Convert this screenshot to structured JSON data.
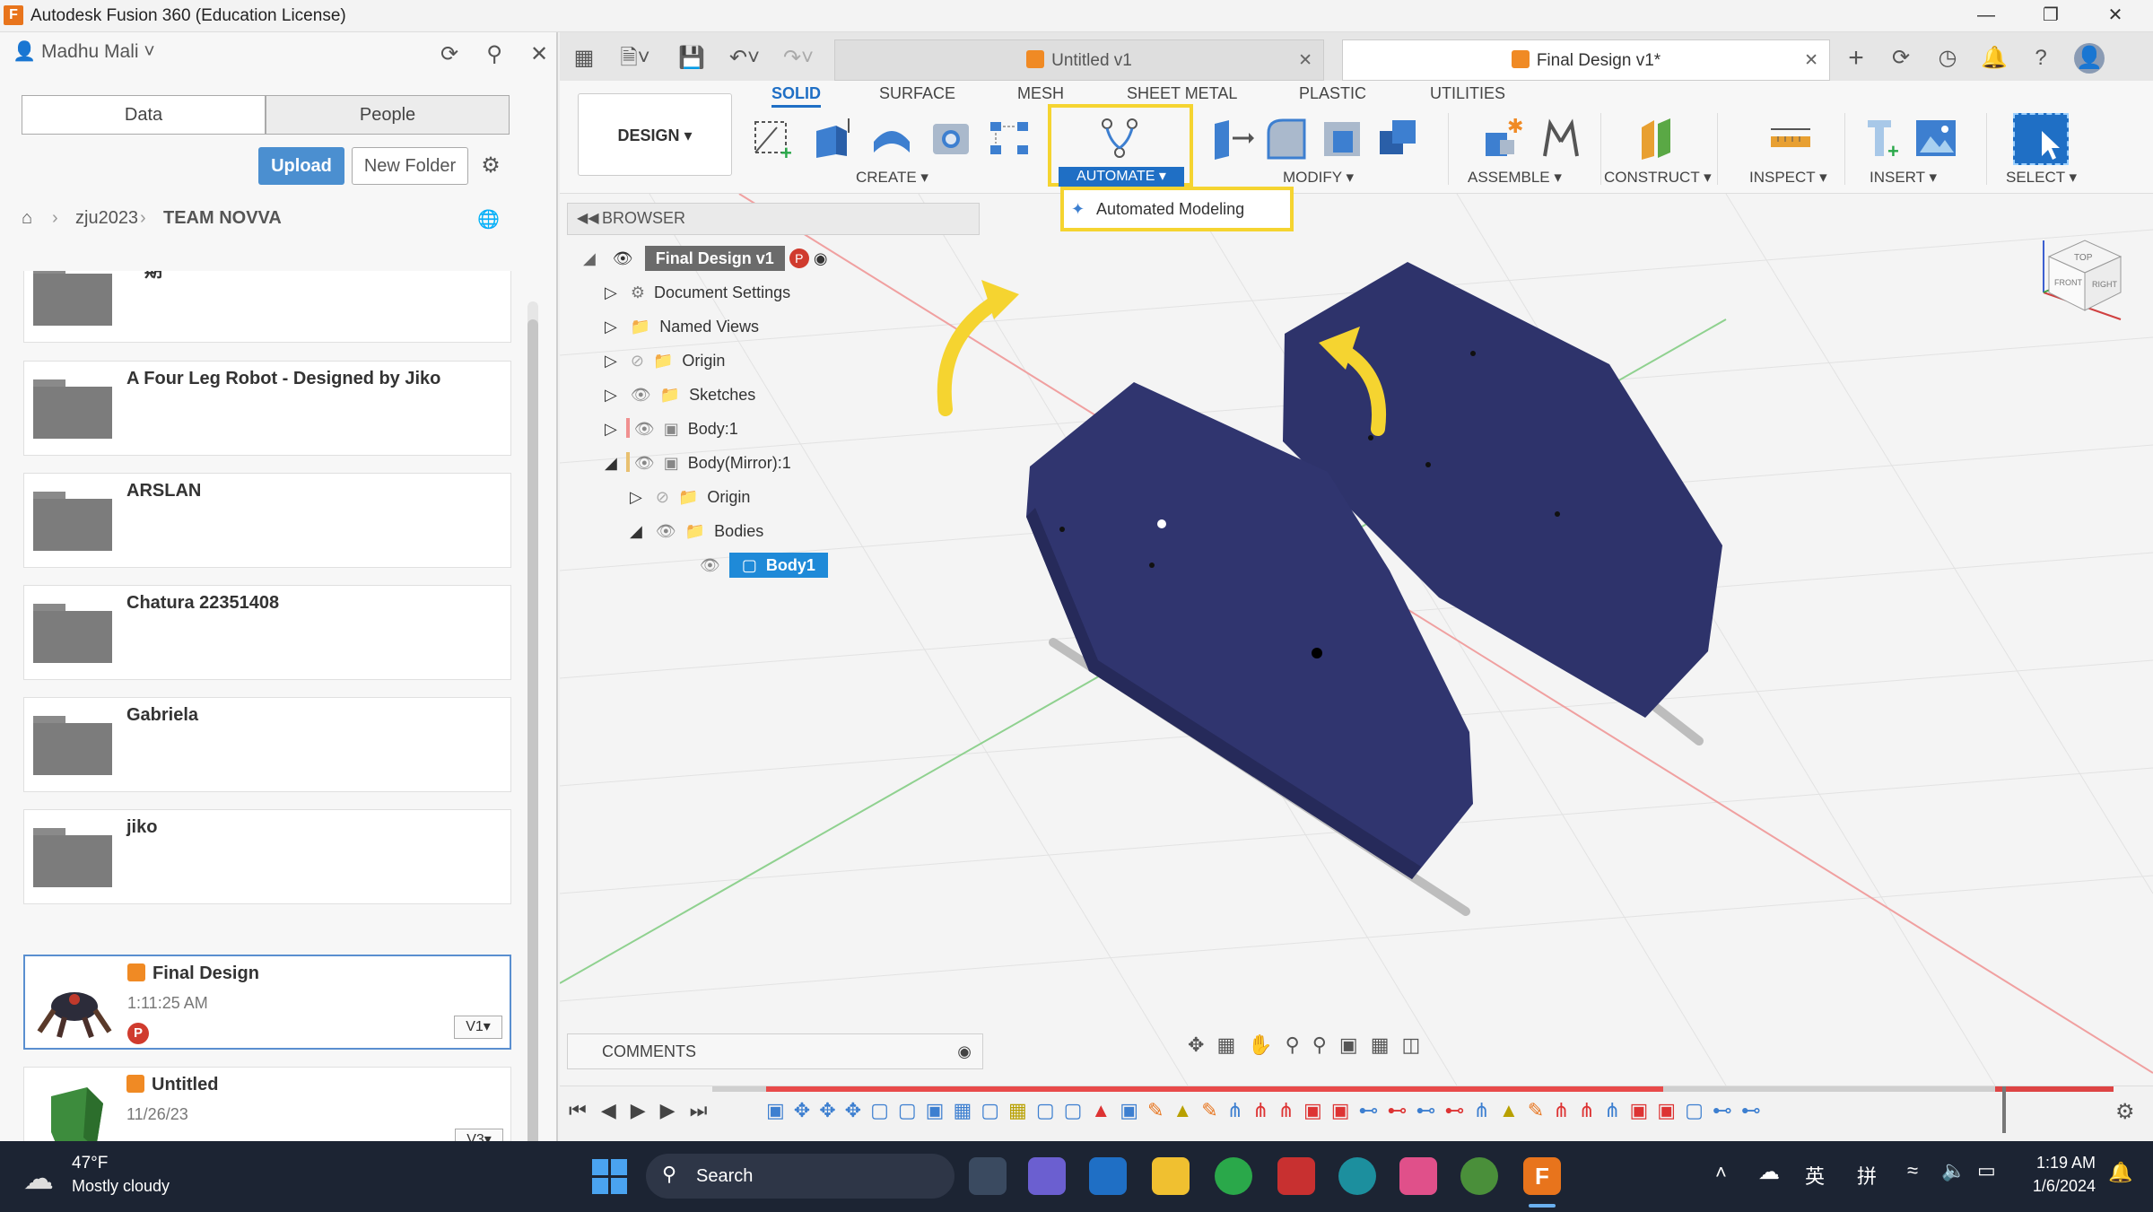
{
  "window": {
    "title": "Autodesk Fusion 360 (Education License)",
    "logo_letter": "F"
  },
  "datapanel": {
    "user": "Madhu Mali",
    "tabs": [
      "Data",
      "People"
    ],
    "upload_label": "Upload",
    "new_folder_label": "New Folder",
    "breadcrumb": [
      "zju2023",
      "TEAM NOVVA"
    ],
    "items": [
      {
        "name": "一期",
        "type": "folder"
      },
      {
        "name": "A Four Leg Robot - Designed by Jiko",
        "type": "folder"
      },
      {
        "name": "ARSLAN",
        "type": "folder"
      },
      {
        "name": "Chatura 22351408",
        "type": "folder"
      },
      {
        "name": "Gabriela",
        "type": "folder"
      },
      {
        "name": "jiko",
        "type": "folder"
      },
      {
        "name": "Final Design",
        "type": "design",
        "date": "1:11:25 AM",
        "version": "V1▾"
      },
      {
        "name": "Untitled",
        "type": "design",
        "date": "11/26/23",
        "version": "V3▾"
      }
    ]
  },
  "doc_tabs": [
    {
      "label": "Untitled v1",
      "active": false
    },
    {
      "label": "Final Design v1*",
      "active": true
    }
  ],
  "ribbon": {
    "workspace": "DESIGN ▾",
    "tabs": [
      "SOLID",
      "SURFACE",
      "MESH",
      "SHEET METAL",
      "PLASTIC",
      "UTILITIES"
    ],
    "active_tab": "SOLID",
    "groups": [
      "CREATE ▾",
      "AUTOMATE ▾",
      "MODIFY ▾",
      "ASSEMBLE ▾",
      "CONSTRUCT ▾",
      "INSPECT ▾",
      "INSERT ▾",
      "SELECT ▾"
    ],
    "automate_menu_item": "Automated Modeling"
  },
  "browser": {
    "title": "BROWSER",
    "root": "Final Design v1",
    "rows": [
      "Document Settings",
      "Named Views",
      "Origin",
      "Sketches",
      "Body:1",
      "Body(Mirror):1",
      "Origin",
      "Bodies",
      "Body1"
    ]
  },
  "comments": {
    "label": "COMMENTS"
  },
  "viewcube": {
    "top": "TOP",
    "front": "FRONT",
    "right": "RIGHT"
  },
  "taskbar": {
    "weather_temp": "47°F",
    "weather_desc": "Mostly cloudy",
    "search_label": "Search",
    "ime1": "英",
    "ime2": "拼",
    "time": "1:19 AM",
    "date": "1/6/2024"
  },
  "colors": {
    "accent": "#1f6fc5",
    "highlight": "#f5d430",
    "body": "#2e336b",
    "taskbar": "#1c2433"
  }
}
